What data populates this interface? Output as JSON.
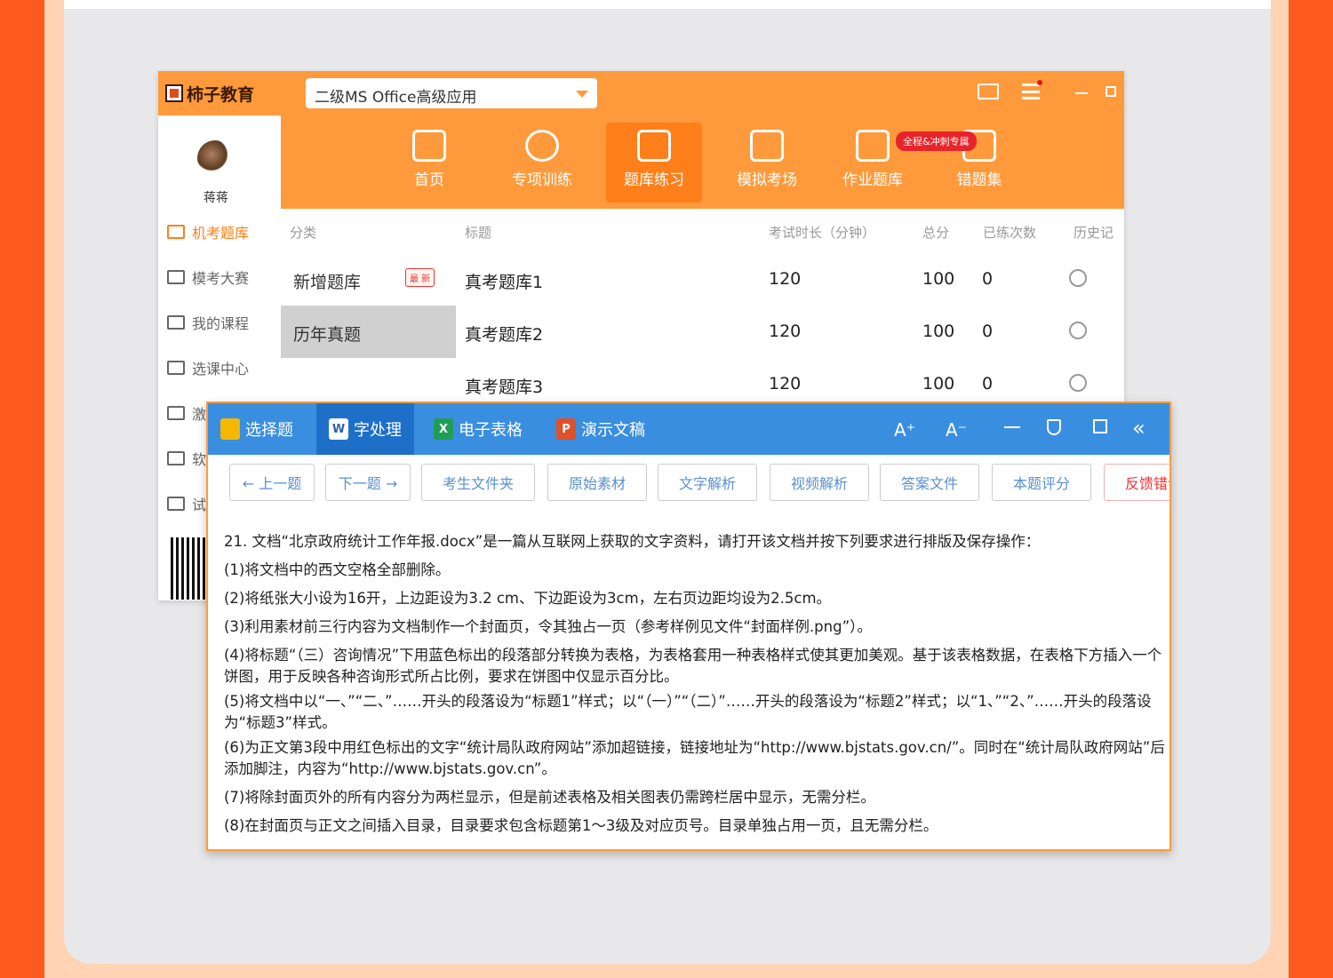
{
  "app": {
    "logo_text": "柿子教育",
    "course_select": "二级MS Office高级应用",
    "username": "蒋蒋"
  },
  "nav": [
    {
      "label": "首页"
    },
    {
      "label": "专项训练"
    },
    {
      "label": "题库练习"
    },
    {
      "label": "模拟考场"
    },
    {
      "label": "作业题库"
    },
    {
      "label": "错题集"
    }
  ],
  "nav_badge": "全程&冲刺专属",
  "sidebar": [
    {
      "label": "机考题库"
    },
    {
      "label": "模考大赛"
    },
    {
      "label": "我的课程"
    },
    {
      "label": "选课中心"
    },
    {
      "label": "激"
    },
    {
      "label": "软"
    },
    {
      "label": "试"
    }
  ],
  "table": {
    "headers": [
      "分类",
      "标题",
      "考试时长（分钟）",
      "总分",
      "已练次数",
      "历史记"
    ],
    "categories": [
      {
        "label": "新增题库",
        "tag": "最 新"
      },
      {
        "label": "历年真题"
      }
    ],
    "rows": [
      {
        "title": "真考题库1",
        "duration": "120",
        "score": "100",
        "count": "0"
      },
      {
        "title": "真考题库2",
        "duration": "120",
        "score": "100",
        "count": "0"
      },
      {
        "title": "真考题库3",
        "duration": "120",
        "score": "100",
        "count": "0"
      }
    ]
  },
  "quiz": {
    "tabs": [
      {
        "label": "选择题",
        "icon": "folder-icon",
        "color": "#f5b800"
      },
      {
        "label": "字处理",
        "icon": "W",
        "color": "#2b5fb8"
      },
      {
        "label": "电子表格",
        "icon": "X",
        "color": "#1f9d55"
      },
      {
        "label": "演示文稿",
        "icon": "P",
        "color": "#e0502a"
      }
    ],
    "controls": [
      "A⁺",
      "A⁻"
    ],
    "tools": [
      "← 上一题",
      "下一题 →",
      "考生文件夹",
      "原始素材",
      "文字解析",
      "视频解析",
      "答案文件",
      "本题评分",
      "反馈错误"
    ],
    "lines": [
      "21. 文档“北京政府统计工作年报.docx”是一篇从互联网上获取的文字资料，请打开该文档并按下列要求进行排版及保存操作：",
      "(1)将文档中的西文空格全部删除。",
      "(2)将纸张大小设为16开，上边距设为3.2 cm、下边距设为3cm，左右页边距均设为2.5cm。",
      "(3)利用素材前三行内容为文档制作一个封面页，令其独占一页（参考样例见文件“封面样例.png”）。",
      "(4)将标题“（三）咨询情况”下用蓝色标出的段落部分转换为表格，为表格套用一种表格样式使其更加美观。基于该表格数据，在表格下方插入一个饼图，用于反映各种咨询形式所占比例，要求在饼图中仅显示百分比。",
      "(5)将文档中以“一、”“二、”……开头的段落设为“标题1”样式；以“（一）”“（二）”……开头的段落设为“标题2”样式；以“1、”“2、”……开头的段落设为“标题3”样式。",
      "(6)为正文第3段中用红色标出的文字“统计局队政府网站”添加超链接，链接地址为“http://www.bjstats.gov.cn/”。同时在“统计局队政府网站”后添加脚注，内容为“http://www.bjstats.gov.cn”。",
      "(7)将除封面页外的所有内容分为两栏显示，但是前述表格及相关图表仍需跨栏居中显示，无需分栏。",
      "(8)在封面页与正文之间插入目录，目录要求包含标题第1～3级及对应页号。目录单独占用一页，且无需分栏。"
    ]
  }
}
